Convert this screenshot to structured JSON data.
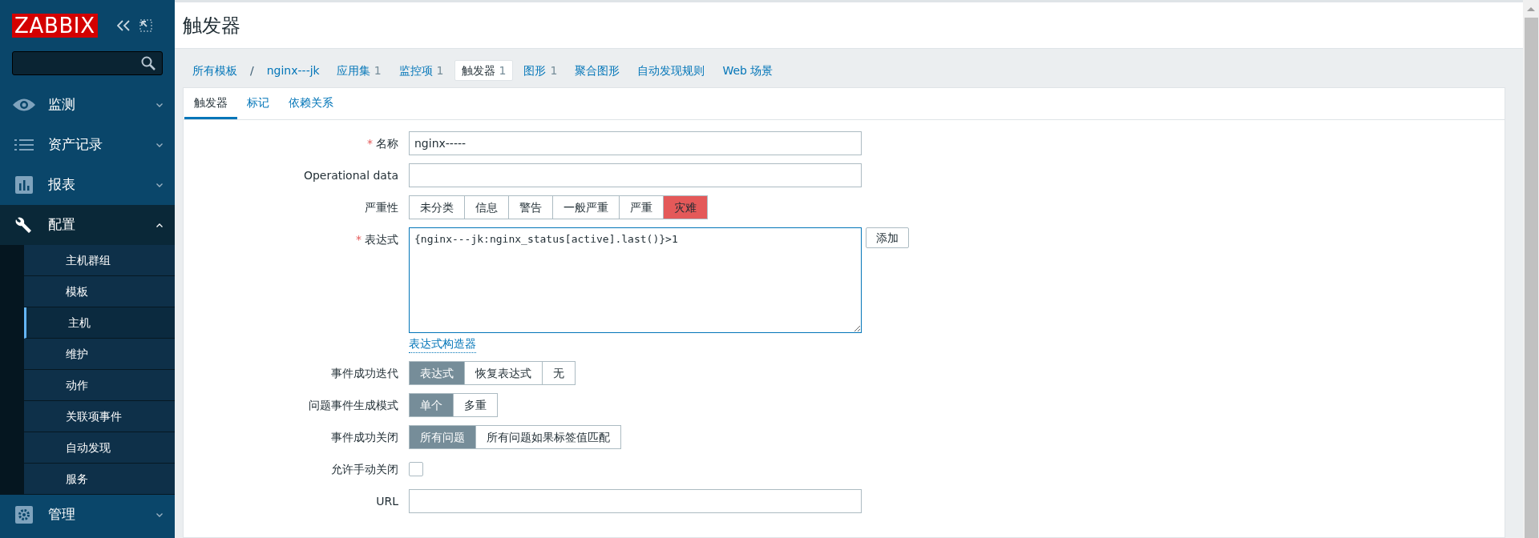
{
  "sidebar": {
    "logo": "ZABBIX",
    "menu": [
      {
        "label": "监测",
        "expanded": false
      },
      {
        "label": "资产记录",
        "expanded": false
      },
      {
        "label": "报表",
        "expanded": false
      },
      {
        "label": "配置",
        "expanded": true,
        "children": [
          {
            "label": "主机群组",
            "selected": false
          },
          {
            "label": "模板",
            "selected": false
          },
          {
            "label": "主机",
            "selected": true
          },
          {
            "label": "维护",
            "selected": false
          },
          {
            "label": "动作",
            "selected": false
          },
          {
            "label": "关联项事件",
            "selected": false
          },
          {
            "label": "自动发现",
            "selected": false
          },
          {
            "label": "服务",
            "selected": false
          }
        ]
      },
      {
        "label": "管理",
        "expanded": false
      }
    ]
  },
  "header": {
    "title": "触发器"
  },
  "breadcrumb": {
    "items": [
      "所有模板",
      "nginx---jk"
    ],
    "separator": "/"
  },
  "nav_tabs": [
    {
      "label": "应用集",
      "count": "1",
      "selected": false
    },
    {
      "label": "监控项",
      "count": "1",
      "selected": false
    },
    {
      "label": "触发器",
      "count": "1",
      "selected": true
    },
    {
      "label": "图形",
      "count": "1",
      "selected": false
    },
    {
      "label": "聚合图形",
      "selected": false
    },
    {
      "label": "自动发现规则",
      "selected": false
    },
    {
      "label": "Web 场景",
      "selected": false
    }
  ],
  "tabs": [
    {
      "label": "触发器",
      "selected": true
    },
    {
      "label": "标记",
      "selected": false
    },
    {
      "label": "依赖关系",
      "selected": false
    }
  ],
  "form": [
    {
      "kind": "input",
      "label": "名称",
      "required_mark": "*",
      "value": "nginx-----"
    },
    {
      "kind": "input",
      "label": "Operational data"
    },
    {
      "kind": "severity",
      "label": "严重性",
      "options": [
        {
          "label": "未分类",
          "selected": false
        },
        {
          "label": "信息",
          "selected": false
        },
        {
          "label": "警告",
          "selected": false
        },
        {
          "label": "一般严重",
          "selected": false
        },
        {
          "label": "严重",
          "selected": false
        },
        {
          "label": "灾难",
          "selected": true
        }
      ]
    },
    {
      "kind": "expression",
      "label": "表达式",
      "required_mark": "*",
      "value": "{nginx---jk:nginx_status[active].last()}>1",
      "button": "添加",
      "link": "表达式构造器"
    },
    {
      "kind": "radio",
      "label": "事件成功迭代",
      "options": [
        {
          "label": "表达式",
          "selected": true
        },
        {
          "label": "恢复表达式",
          "selected": false
        },
        {
          "label": "无",
          "selected": false
        }
      ]
    },
    {
      "kind": "radio",
      "label": "问题事件生成模式",
      "options": [
        {
          "label": "单个",
          "selected": true
        },
        {
          "label": "多重",
          "selected": false
        }
      ]
    },
    {
      "kind": "radio",
      "label": "事件成功关闭",
      "options": [
        {
          "label": "所有问题",
          "selected": true
        },
        {
          "label": "所有问题如果标签值匹配",
          "selected": false
        }
      ]
    },
    {
      "kind": "checkbox",
      "label": "允许手动关闭",
      "checked": false
    },
    {
      "kind": "input",
      "label": "URL"
    }
  ]
}
